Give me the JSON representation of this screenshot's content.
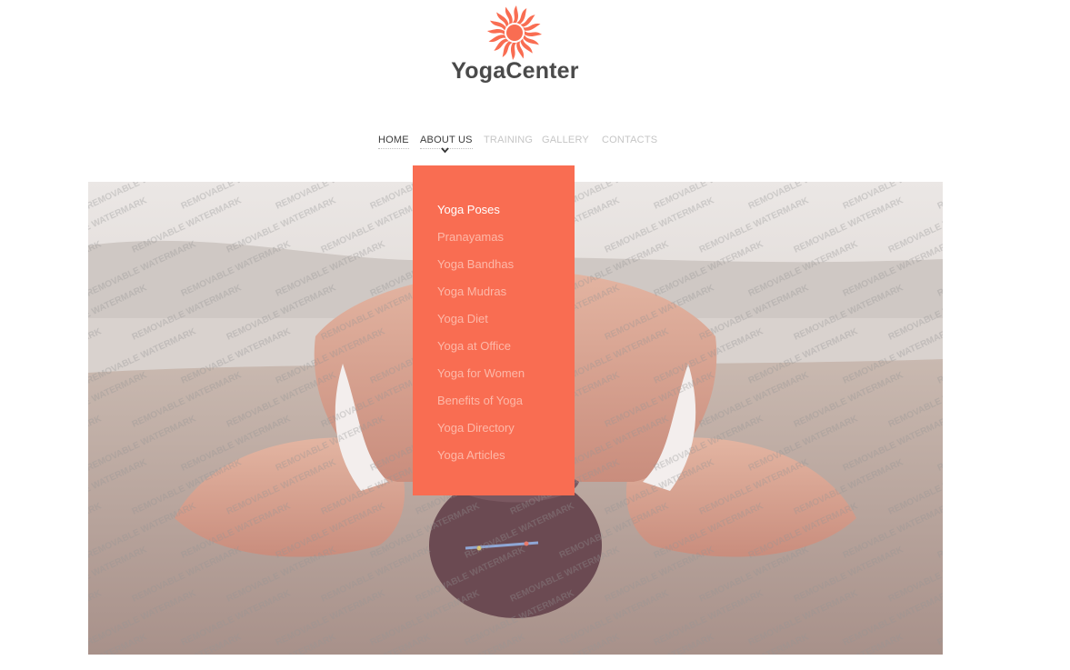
{
  "header": {
    "logo_icon": "sun-icon",
    "brand_name": "YogaCenter",
    "accent_color": "#f96d52"
  },
  "nav": {
    "items": [
      {
        "label": "HOME"
      },
      {
        "label": "ABOUT US"
      },
      {
        "label": "TRAINING"
      },
      {
        "label": "GALLERY"
      },
      {
        "label": "CONTACTS"
      }
    ]
  },
  "dropdown": {
    "items": [
      {
        "label": "Yoga Poses",
        "active": true
      },
      {
        "label": "Pranayamas"
      },
      {
        "label": "Yoga Bandhas"
      },
      {
        "label": "Yoga Mudras"
      },
      {
        "label": "Yoga Diet"
      },
      {
        "label": "Yoga at Office"
      },
      {
        "label": "Yoga for Women"
      },
      {
        "label": "Benefits of Yoga"
      },
      {
        "label": "Yoga Directory"
      },
      {
        "label": "Yoga Articles"
      }
    ]
  },
  "hero": {
    "image": "yoga-pose-photo",
    "watermark_text": "REMOVABLE WATERMARK"
  }
}
